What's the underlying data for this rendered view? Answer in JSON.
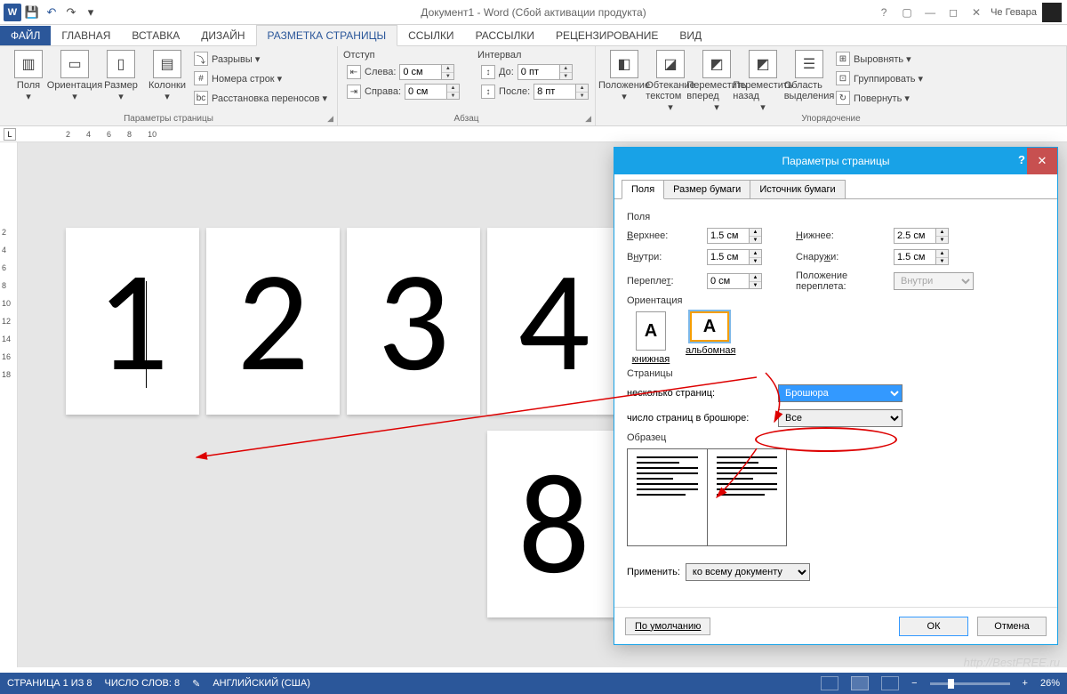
{
  "title": "Документ1 - Word (Сбой активации продукта)",
  "user": "Че Гевара",
  "tabs": {
    "file": "ФАЙЛ",
    "home": "ГЛАВНАЯ",
    "insert": "ВСТАВКА",
    "design": "ДИЗАЙН",
    "layout": "РАЗМЕТКА СТРАНИЦЫ",
    "references": "ССЫЛКИ",
    "mailings": "РАССЫЛКИ",
    "review": "РЕЦЕНЗИРОВАНИЕ",
    "view": "ВИД"
  },
  "ribbon": {
    "pageSetup": {
      "margins": "Поля",
      "orientation": "Ориентация",
      "size": "Размер",
      "columns": "Колонки",
      "breaks": "Разрывы ▾",
      "lineNumbers": "Номера строк ▾",
      "hyphenation": "Расстановка переносов ▾",
      "label": "Параметры страницы"
    },
    "paragraph": {
      "indentLabel": "Отступ",
      "left": "Слева:",
      "right": "Справа:",
      "leftVal": "0 см",
      "rightVal": "0 см",
      "spacingLabel": "Интервал",
      "before": "До:",
      "after": "После:",
      "beforeVal": "0 пт",
      "afterVal": "8 пт",
      "label": "Абзац"
    },
    "arrange": {
      "position": "Положение",
      "wrap": "Обтекание текстом",
      "forward": "Переместить вперед",
      "backward": "Переместить назад",
      "selection": "Область выделения",
      "align": "Выровнять ▾",
      "group": "Группировать ▾",
      "rotate": "Повернуть ▾",
      "label": "Упорядочение"
    }
  },
  "ruler": {
    "marks": [
      "2",
      "4",
      "6",
      "8",
      "10"
    ],
    "vmarks": [
      "2",
      "4",
      "6",
      "8",
      "10",
      "12",
      "14",
      "16",
      "18"
    ]
  },
  "pages": [
    "1",
    "2",
    "3",
    "4",
    "8"
  ],
  "dialog": {
    "title": "Параметры страницы",
    "tabs": {
      "margins": "Поля",
      "paper": "Размер бумаги",
      "source": "Источник бумаги"
    },
    "margins": {
      "section": "Поля",
      "top": "Верхнее:",
      "topVal": "1.5 см",
      "bottom": "Нижнее:",
      "bottomVal": "2.5 см",
      "inside": "Внутри:",
      "insideVal": "1.5 см",
      "outside": "Снаружи:",
      "outsideVal": "1.5 см",
      "gutter": "Переплет:",
      "gutterVal": "0 см",
      "gutterPos": "Положение переплета:",
      "gutterPosVal": "Внутри"
    },
    "orientation": {
      "label": "Ориентация",
      "portrait": "книжная",
      "landscape": "альбомная"
    },
    "pages": {
      "label": "Страницы",
      "multi": "несколько страниц:",
      "multiVal": "Брошюра",
      "sheets": "число страниц в брошюре:",
      "sheetsVal": "Все"
    },
    "preview": "Образец",
    "applyTo": "Применить:",
    "applyToVal": "ко всему документу",
    "default": "По умолчанию",
    "ok": "ОК",
    "cancel": "Отмена"
  },
  "status": {
    "page": "СТРАНИЦА 1 ИЗ 8",
    "words": "ЧИСЛО СЛОВ: 8",
    "lang": "АНГЛИЙСКИЙ (США)",
    "zoom": "26%"
  },
  "watermark": "http://BestFREE.ru"
}
